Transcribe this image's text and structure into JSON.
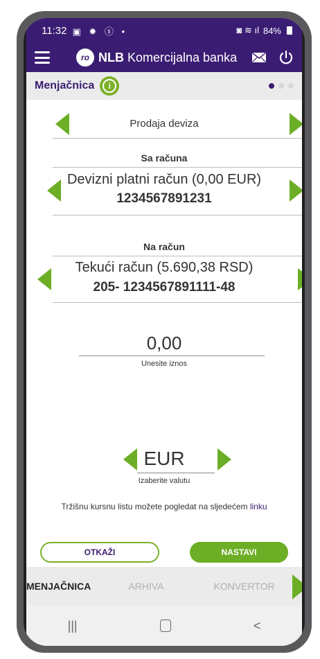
{
  "status": {
    "time": "11:32",
    "left_icons": "▣ ✹ ⓢ •",
    "right_icons": "◙ ≋ ıl",
    "battery": "84%"
  },
  "appbar": {
    "brand_bold": "NLB",
    "brand_rest": " Komercijalna banka",
    "logo": "ro"
  },
  "subhead": {
    "title": "Menjačnica",
    "info": "i"
  },
  "form": {
    "transaction_type": "Prodaja deviza",
    "from_label": "Sa računa",
    "from_account_name": "Devizni platni račun (0,00 EUR)",
    "from_account_number": "1234567891231",
    "to_label": "Na račun",
    "to_account_name": "Tekući račun (5.690,38 RSD)",
    "to_account_number": "205- 1234567891111-48",
    "amount": "0,00",
    "amount_hint": "Unesite iznos",
    "currency": "EUR",
    "currency_hint": "Izaberite valutu",
    "note": "Tržišnu kursnu listu možete pogledat na sljedećem ",
    "note_link": "linku"
  },
  "buttons": {
    "cancel": "OTKAŽI",
    "next": "NASTAVI"
  },
  "tabs": [
    "MENJAČNICA",
    "ARHIVA",
    "KONVERTOR"
  ],
  "nav": {
    "recent": "|||",
    "back": "<"
  },
  "colors": {
    "brand_purple": "#3a1d72",
    "accent_green": "#6cae25"
  }
}
